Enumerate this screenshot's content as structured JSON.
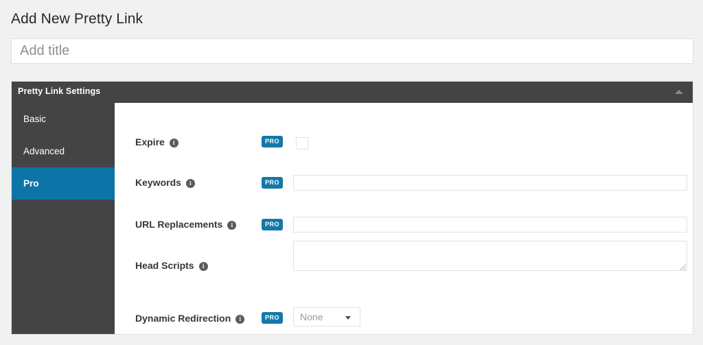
{
  "page": {
    "title": "Add New Pretty Link",
    "background_color": "#f1f1f1"
  },
  "title_field": {
    "name": "post-title",
    "value": "",
    "placeholder": "Add title"
  },
  "panel": {
    "header_title": "Pretty Link Settings",
    "collapse_icon": "triangle-up-icon",
    "accent_color": "#0d74a8",
    "header_color": "#444444",
    "tabs": [
      {
        "label": "Basic",
        "active": false
      },
      {
        "label": "Advanced",
        "active": false
      },
      {
        "label": "Pro",
        "active": true
      }
    ],
    "fields": [
      {
        "label": "Expire",
        "info_icon": "info-icon",
        "pro_badge": "PRO",
        "has_pro_badge": true,
        "control": "checkbox",
        "value": "",
        "checked": false
      },
      {
        "label": "Keywords",
        "info_icon": "info-icon",
        "pro_badge": "PRO",
        "has_pro_badge": true,
        "control": "text",
        "value": "",
        "placeholder": ""
      },
      {
        "label": "URL Replacements",
        "info_icon": "info-icon",
        "pro_badge": "PRO",
        "has_pro_badge": true,
        "control": "text",
        "value": "",
        "placeholder": ""
      },
      {
        "label": "Head Scripts",
        "info_icon": "info-icon",
        "pro_badge": "",
        "has_pro_badge": false,
        "control": "textarea",
        "value": "",
        "placeholder": ""
      },
      {
        "label": "Dynamic Redirection",
        "info_icon": "info-icon",
        "pro_badge": "PRO",
        "has_pro_badge": true,
        "control": "select",
        "value": "None",
        "options": [
          "None"
        ]
      }
    ]
  },
  "glyphs": {
    "info": "i"
  }
}
